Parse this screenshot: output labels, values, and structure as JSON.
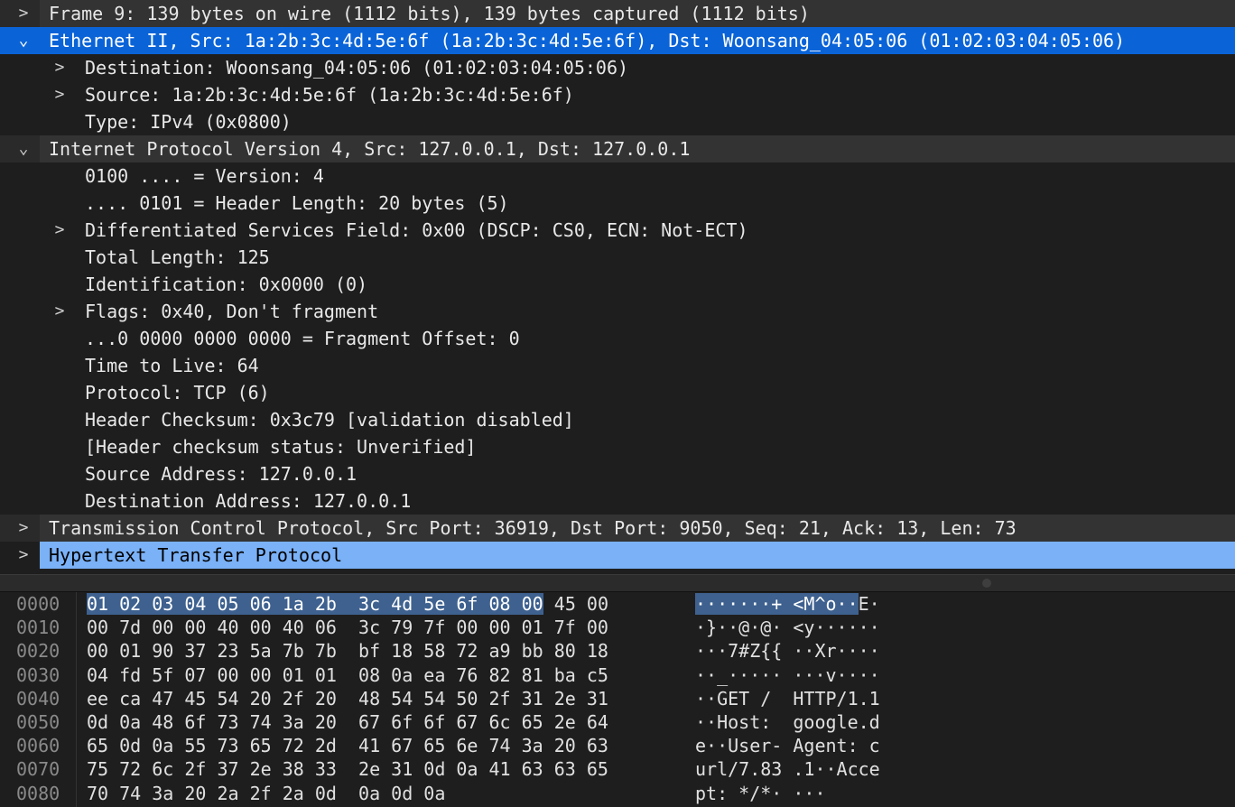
{
  "tree": [
    {
      "level": 0,
      "expander": ">",
      "label": "Frame 9: 139 bytes on wire (1112 bits), 139 bytes captured (1112 bits)",
      "state": "normal",
      "shade": true
    },
    {
      "level": 0,
      "expander": "⌄",
      "label": "Ethernet II, Src: 1a:2b:3c:4d:5e:6f (1a:2b:3c:4d:5e:6f), Dst: Woonsang_04:05:06 (01:02:03:04:05:06)",
      "state": "selected"
    },
    {
      "level": 1,
      "expander": ">",
      "label": "Destination: Woonsang_04:05:06 (01:02:03:04:05:06)",
      "state": "normal"
    },
    {
      "level": 1,
      "expander": ">",
      "label": "Source: 1a:2b:3c:4d:5e:6f (1a:2b:3c:4d:5e:6f)",
      "state": "normal"
    },
    {
      "level": 1,
      "expander": "",
      "label": "Type: IPv4 (0x0800)",
      "state": "normal"
    },
    {
      "level": 0,
      "expander": "⌄",
      "label": "Internet Protocol Version 4, Src: 127.0.0.1, Dst: 127.0.0.1",
      "state": "normal",
      "shade": true
    },
    {
      "level": 1,
      "expander": "",
      "label": "0100 .... = Version: 4",
      "state": "normal"
    },
    {
      "level": 1,
      "expander": "",
      "label": ".... 0101 = Header Length: 20 bytes (5)",
      "state": "normal"
    },
    {
      "level": 1,
      "expander": ">",
      "label": "Differentiated Services Field: 0x00 (DSCP: CS0, ECN: Not-ECT)",
      "state": "normal"
    },
    {
      "level": 1,
      "expander": "",
      "label": "Total Length: 125",
      "state": "normal"
    },
    {
      "level": 1,
      "expander": "",
      "label": "Identification: 0x0000 (0)",
      "state": "normal"
    },
    {
      "level": 1,
      "expander": ">",
      "label": "Flags: 0x40, Don't fragment",
      "state": "normal"
    },
    {
      "level": 1,
      "expander": "",
      "label": "...0 0000 0000 0000 = Fragment Offset: 0",
      "state": "normal"
    },
    {
      "level": 1,
      "expander": "",
      "label": "Time to Live: 64",
      "state": "normal"
    },
    {
      "level": 1,
      "expander": "",
      "label": "Protocol: TCP (6)",
      "state": "normal"
    },
    {
      "level": 1,
      "expander": "",
      "label": "Header Checksum: 0x3c79 [validation disabled]",
      "state": "normal"
    },
    {
      "level": 1,
      "expander": "",
      "label": "[Header checksum status: Unverified]",
      "state": "normal"
    },
    {
      "level": 1,
      "expander": "",
      "label": "Source Address: 127.0.0.1",
      "state": "normal"
    },
    {
      "level": 1,
      "expander": "",
      "label": "Destination Address: 127.0.0.1",
      "state": "normal"
    },
    {
      "level": 0,
      "expander": ">",
      "label": "Transmission Control Protocol, Src Port: 36919, Dst Port: 9050, Seq: 21, Ack: 13, Len: 73",
      "state": "normal",
      "shade": true
    },
    {
      "level": 0,
      "expander": ">",
      "label": "Hypertext Transfer Protocol",
      "state": "highlight"
    }
  ],
  "hex": [
    {
      "offset": "0000",
      "bytes_sel": "01 02 03 04 05 06 1a 2b  3c 4d 5e 6f 08 00",
      "bytes_rest": " 45 00",
      "ascii_sel": "·······+ <M^o··",
      "ascii_rest": "E·"
    },
    {
      "offset": "0010",
      "bytes_sel": "",
      "bytes_rest": "00 7d 00 00 40 00 40 06  3c 79 7f 00 00 01 7f 00",
      "ascii_sel": "",
      "ascii_rest": "·}··@·@· <y······"
    },
    {
      "offset": "0020",
      "bytes_sel": "",
      "bytes_rest": "00 01 90 37 23 5a 7b 7b  bf 18 58 72 a9 bb 80 18",
      "ascii_sel": "",
      "ascii_rest": "···7#Z{{ ··Xr····"
    },
    {
      "offset": "0030",
      "bytes_sel": "",
      "bytes_rest": "04 fd 5f 07 00 00 01 01  08 0a ea 76 82 81 ba c5",
      "ascii_sel": "",
      "ascii_rest": "··_····· ···v····"
    },
    {
      "offset": "0040",
      "bytes_sel": "",
      "bytes_rest": "ee ca 47 45 54 20 2f 20  48 54 54 50 2f 31 2e 31",
      "ascii_sel": "",
      "ascii_rest": "··GET /  HTTP/1.1"
    },
    {
      "offset": "0050",
      "bytes_sel": "",
      "bytes_rest": "0d 0a 48 6f 73 74 3a 20  67 6f 6f 67 6c 65 2e 64",
      "ascii_sel": "",
      "ascii_rest": "··Host:  google.d"
    },
    {
      "offset": "0060",
      "bytes_sel": "",
      "bytes_rest": "65 0d 0a 55 73 65 72 2d  41 67 65 6e 74 3a 20 63",
      "ascii_sel": "",
      "ascii_rest": "e··User- Agent: c"
    },
    {
      "offset": "0070",
      "bytes_sel": "",
      "bytes_rest": "75 72 6c 2f 37 2e 38 33  2e 31 0d 0a 41 63 63 65",
      "ascii_sel": "",
      "ascii_rest": "url/7.83 .1··Acce"
    },
    {
      "offset": "0080",
      "bytes_sel": "",
      "bytes_rest": "70 74 3a 20 2a 2f 2a 0d  0a 0d 0a",
      "ascii_sel": "",
      "ascii_rest": "pt: */*· ···"
    }
  ]
}
